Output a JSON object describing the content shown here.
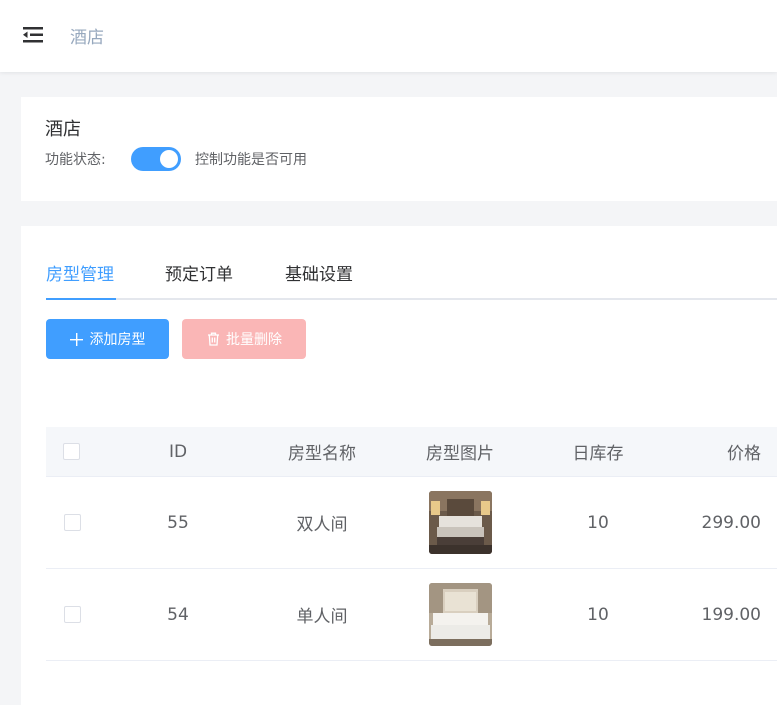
{
  "header": {
    "breadcrumb": "酒店",
    "menu_icon": "menu-fold-icon"
  },
  "plugin": {
    "title": "酒店",
    "status_label": "功能状态:",
    "switch_on": true,
    "switch_desc": "控制功能是否可用"
  },
  "tabs": [
    {
      "label": "房型管理",
      "active": true
    },
    {
      "label": "预定订单",
      "active": false
    },
    {
      "label": "基础设置",
      "active": false
    }
  ],
  "actions": {
    "add_label": "添加房型",
    "delete_label": "批量删除"
  },
  "table": {
    "columns": [
      "ID",
      "房型名称",
      "房型图片",
      "日库存",
      "价格"
    ],
    "rows": [
      {
        "id": "55",
        "name": "双人间",
        "image": "room-photo-double",
        "stock": "10",
        "price": "299.00"
      },
      {
        "id": "54",
        "name": "单人间",
        "image": "room-photo-single",
        "stock": "10",
        "price": "199.00"
      }
    ]
  },
  "colors": {
    "primary": "#409eff",
    "danger_disabled": "#fab6b6"
  }
}
